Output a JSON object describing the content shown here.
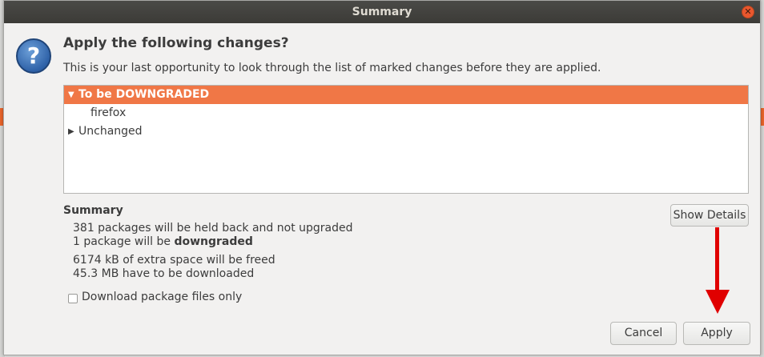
{
  "window": {
    "title": "Summary"
  },
  "heading": "Apply the following changes?",
  "subtext": "This is your last opportunity to look through the list of marked changes before they are applied.",
  "tree": {
    "groups": [
      {
        "label": "To be DOWNGRADED",
        "expanded": true,
        "selected": true,
        "children": [
          "firefox"
        ]
      },
      {
        "label": "Unchanged",
        "expanded": false,
        "selected": false
      }
    ]
  },
  "summary": {
    "title": "Summary",
    "line1": "381 packages will be held back and not upgraded",
    "line2_prefix": "1 package will be ",
    "line2_bold": "downgraded",
    "line3": "6174 kB of extra space will be freed",
    "line4": "45.3 MB have to be downloaded"
  },
  "buttons": {
    "show_details": "Show Details",
    "cancel": "Cancel",
    "apply": "Apply"
  },
  "checkbox": {
    "label": "Download package files only",
    "checked": false
  },
  "colors": {
    "selection": "#f07746",
    "annotation_arrow": "#e00000",
    "titlebar": "#3c3b37"
  }
}
